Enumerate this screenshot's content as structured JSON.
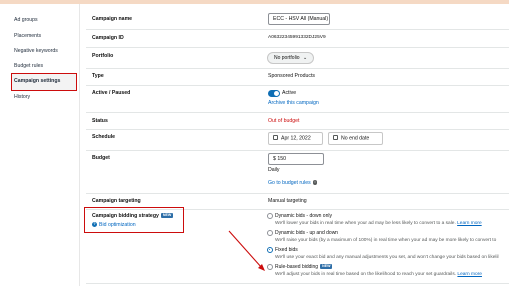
{
  "sidebar": {
    "items": [
      {
        "label": "Ad groups"
      },
      {
        "label": "Placements"
      },
      {
        "label": "Negative keywords"
      },
      {
        "label": "Budget rules"
      },
      {
        "label": "Campaign settings"
      },
      {
        "label": "History"
      }
    ],
    "active_index": 4
  },
  "settings": {
    "campaign_name": {
      "label": "Campaign name",
      "value": "ECC - HSV All (Manual)"
    },
    "campaign_id": {
      "label": "Campaign ID",
      "value": "A06322345991332DJ25V9"
    },
    "portfolio": {
      "label": "Portfolio",
      "value": "No portfolio"
    },
    "type": {
      "label": "Type",
      "value": "Sponsored Products"
    },
    "active_paused": {
      "label": "Active / Paused",
      "toggle_label": "Active",
      "archive_link": "Archive this campaign"
    },
    "status": {
      "label": "Status",
      "value": "Out of budget"
    },
    "schedule": {
      "label": "Schedule",
      "start": "Apr 12, 2022",
      "end": "No end date"
    },
    "budget": {
      "label": "Budget",
      "amount": "$ 150",
      "period": "Daily",
      "rules_link": "Go to budget rules"
    },
    "targeting": {
      "label": "Campaign targeting",
      "value": "Manual targeting"
    },
    "bidding": {
      "label": "Campaign bidding strategy",
      "label_badge": "NEW",
      "help_link": "Bid optimization",
      "options": [
        {
          "title": "Dynamic bids - down only",
          "desc": "We'll lower your bids in real time when your ad may be less likely to convert to a sale.",
          "learn_more": "Learn more",
          "selected": false
        },
        {
          "title": "Dynamic bids - up and down",
          "desc": "We'll raise your bids (by a maximum of 100%) in real time when your ad may be more likely to convert to",
          "learn_more": "",
          "selected": false
        },
        {
          "title": "Fixed bids",
          "desc": "We'll use your exact bid and any manual adjustments you set, and won't change your bids based on likelil",
          "learn_more": "",
          "selected": true
        },
        {
          "title": "Rule-based bidding",
          "badge": "NEW",
          "desc": "We'll adjust your bids in real time based on the likelihood to reach your set guardrails.",
          "learn_more": "Learn more",
          "selected": false
        }
      ]
    }
  },
  "colors": {
    "accent_blue": "#0f6eb4",
    "link": "#0066c0",
    "highlight_red": "#cc0c0c",
    "status_red": "#cc0c0c"
  }
}
